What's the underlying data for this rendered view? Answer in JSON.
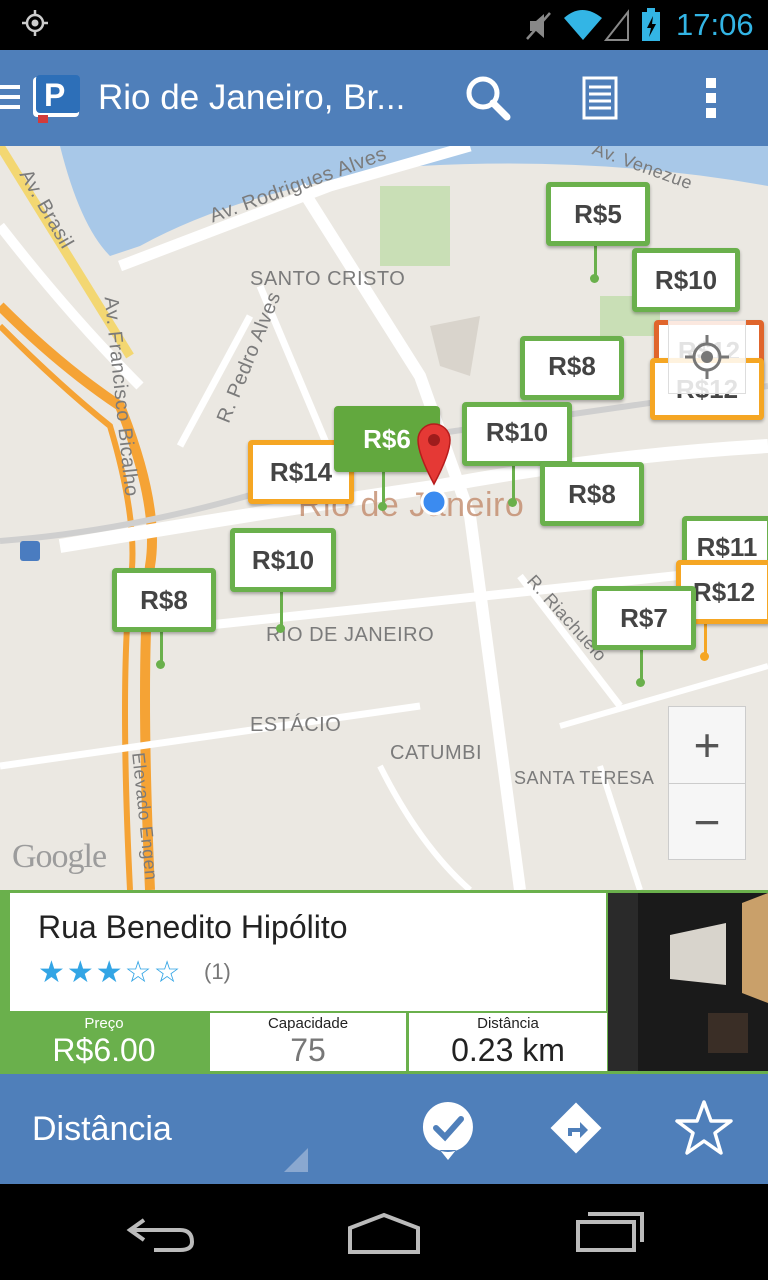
{
  "status_bar": {
    "time": "17:06"
  },
  "action_bar": {
    "title": "Rio de Janeiro, Br..."
  },
  "map": {
    "street_labels": [
      "Av. Rodrigues Alves",
      "Av. Brasil",
      "SANTO CRISTO",
      "R. Pedro Alves",
      "Av. Francisco Bicalho",
      "Rio de Janeiro",
      "RIO DE JANEIRO",
      "ESTÁCIO",
      "CATUMBI",
      "SANTA TERESA",
      "R. Riachuelo",
      "Elevado Engen",
      "Av. Venezue"
    ],
    "attribution": "Google",
    "price_pins": [
      {
        "label": "R$5",
        "color": "green"
      },
      {
        "label": "R$10",
        "color": "green"
      },
      {
        "label": "R$8",
        "color": "green"
      },
      {
        "label": "R$12",
        "color": "orange"
      },
      {
        "label": "R$12",
        "color": "red"
      },
      {
        "label": "R$10",
        "color": "green"
      },
      {
        "label": "R$14",
        "color": "orange"
      },
      {
        "label": "R$6",
        "color": "green",
        "selected": true
      },
      {
        "label": "R$10",
        "color": "green"
      },
      {
        "label": "R$8",
        "color": "green"
      },
      {
        "label": "R$8",
        "color": "green"
      },
      {
        "label": "R$11",
        "color": "green"
      },
      {
        "label": "R$12",
        "color": "orange"
      },
      {
        "label": "R$7",
        "color": "green"
      }
    ],
    "zoom_in": "+",
    "zoom_out": "−"
  },
  "detail_card": {
    "name": "Rua Benedito Hipólito",
    "rating_stars": "★★★☆☆",
    "rating_value": 3,
    "rating_max": 5,
    "review_count": "(1)",
    "price_label": "Preço",
    "price_value": "R$6.00",
    "capacity_label": "Capacidade",
    "capacity_value": "75",
    "distance_label": "Distância",
    "distance_value": "0.23 km"
  },
  "bottom_bar": {
    "sort_label": "Distância"
  },
  "colors": {
    "action_bar": "#4f7fba",
    "pin_green": "#6ab04c",
    "pin_orange": "#f5a623",
    "accent_blue": "#33b5e5"
  }
}
